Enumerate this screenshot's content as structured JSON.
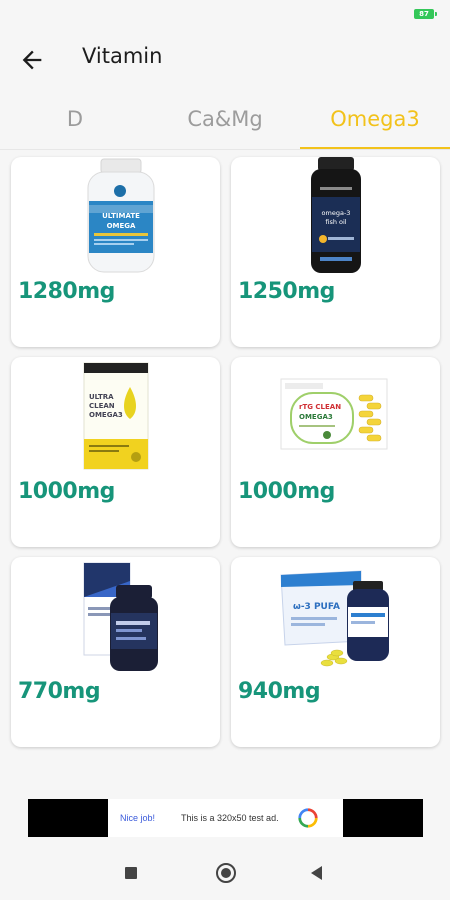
{
  "status": {
    "battery": "87"
  },
  "header": {
    "title": "Vitamin"
  },
  "tabs": [
    {
      "label": "D",
      "active": false
    },
    {
      "label": "Ca&Mg",
      "active": false
    },
    {
      "label": "Omega3",
      "active": true
    }
  ],
  "products": [
    {
      "dose": "1280mg",
      "label_lines": [
        "ULTIMATE",
        "OMEGA"
      ]
    },
    {
      "dose": "1250mg",
      "label_lines": [
        "omega-3",
        "fish oil"
      ]
    },
    {
      "dose": "1000mg",
      "label_lines": [
        "ULTRA",
        "CLEAN",
        "OMEGA3"
      ]
    },
    {
      "dose": "1000mg",
      "label_lines": [
        "rTG CLEAN",
        "OMEGA3"
      ]
    },
    {
      "dose": "770mg",
      "label_lines": []
    },
    {
      "dose": "940mg",
      "label_lines": [
        "ω-3 PUFA"
      ]
    }
  ],
  "ad": {
    "headline": "Nice job!",
    "text": "This is a 320x50 test ad."
  },
  "colors": {
    "accent": "#f2c21b",
    "dose": "#17957a"
  }
}
